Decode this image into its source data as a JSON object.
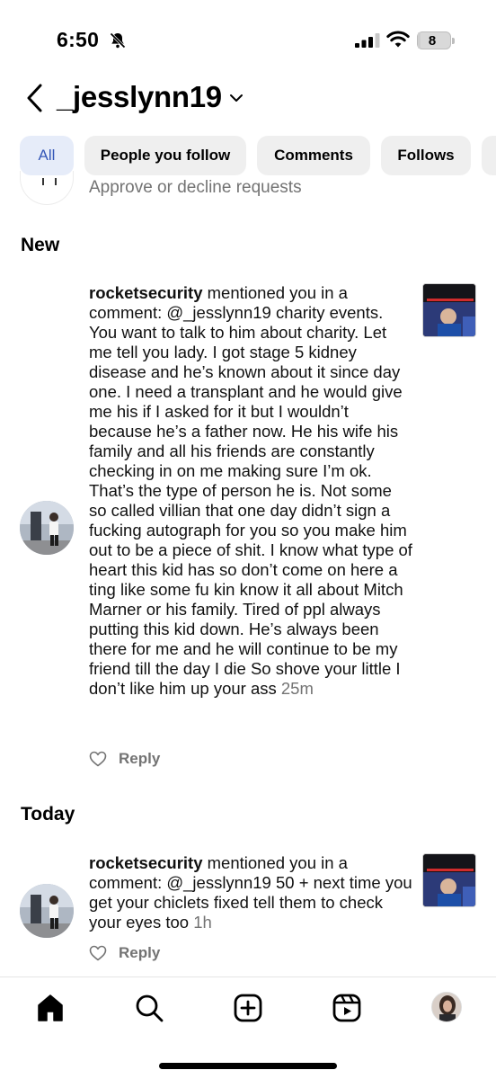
{
  "status_bar": {
    "time": "6:50",
    "battery_level": "8"
  },
  "header": {
    "account_name": "_jesslynn19"
  },
  "filters": [
    {
      "label": "All",
      "active": true
    },
    {
      "label": "People you follow",
      "active": false
    },
    {
      "label": "Comments",
      "active": false
    },
    {
      "label": "Follows",
      "active": false
    }
  ],
  "requests": {
    "subtitle": "Approve or decline requests"
  },
  "sections": {
    "new_title": "New",
    "today_title": "Today"
  },
  "notifications": [
    {
      "username": "rocketsecurity",
      "message": " mentioned you in a comment: @_jesslynn19 charity events. You want to talk to him about charity. Let me tell you lady.  I got stage 5 kidney disease and he’s known about it since day one.  I need a transplant and he would give me his if I asked for it but I wouldn’t because he’s a father now.  He his wife his family and all his friends are constantly checking in on me making sure I’m ok.  That’s the type of person he is. Not some so called villian that one day didn’t sign a fucking autograph for you so you make him out to be a piece of shit.  I know what type of heart this kid has so don’t come on here a ting like some fu kin know it all about Mitch Marner or his family.  Tired of ppl always putting this kid down. He’s always been there for me and he will continue to be my friend till the day I die  So shove your little I don’t like him up your ass",
      "time": "25m",
      "reply_label": "Reply",
      "thumb_caption": "WHEN YOUR FAMILY'S SAFETY COMES INTO QUESTION... I DON'T THINK IT'S ACCEPTABLE."
    },
    {
      "username": "rocketsecurity",
      "message": " mentioned you in a comment: @_jesslynn19 50 + next time you get your chiclets fixed tell them to check your eyes too",
      "time": "1h",
      "reply_label": "Reply",
      "thumb_caption": "WHEN YOUR FAMILY'S SAFETY COMES INTO QUESTION... I DON'T THINK IT'S ACCEPTABLE."
    }
  ],
  "icons": [
    "bell-off-icon",
    "signal-icon",
    "wifi-icon",
    "battery-icon",
    "back-icon",
    "chevron-down-icon",
    "heart-icon",
    "home-icon",
    "search-icon",
    "create-icon",
    "reels-icon",
    "profile-avatar"
  ],
  "colors": {
    "active_chip_bg": "#e6ecf9",
    "active_chip_text": "#3557b8",
    "chip_bg": "#efefef",
    "secondary_text": "#737373"
  }
}
